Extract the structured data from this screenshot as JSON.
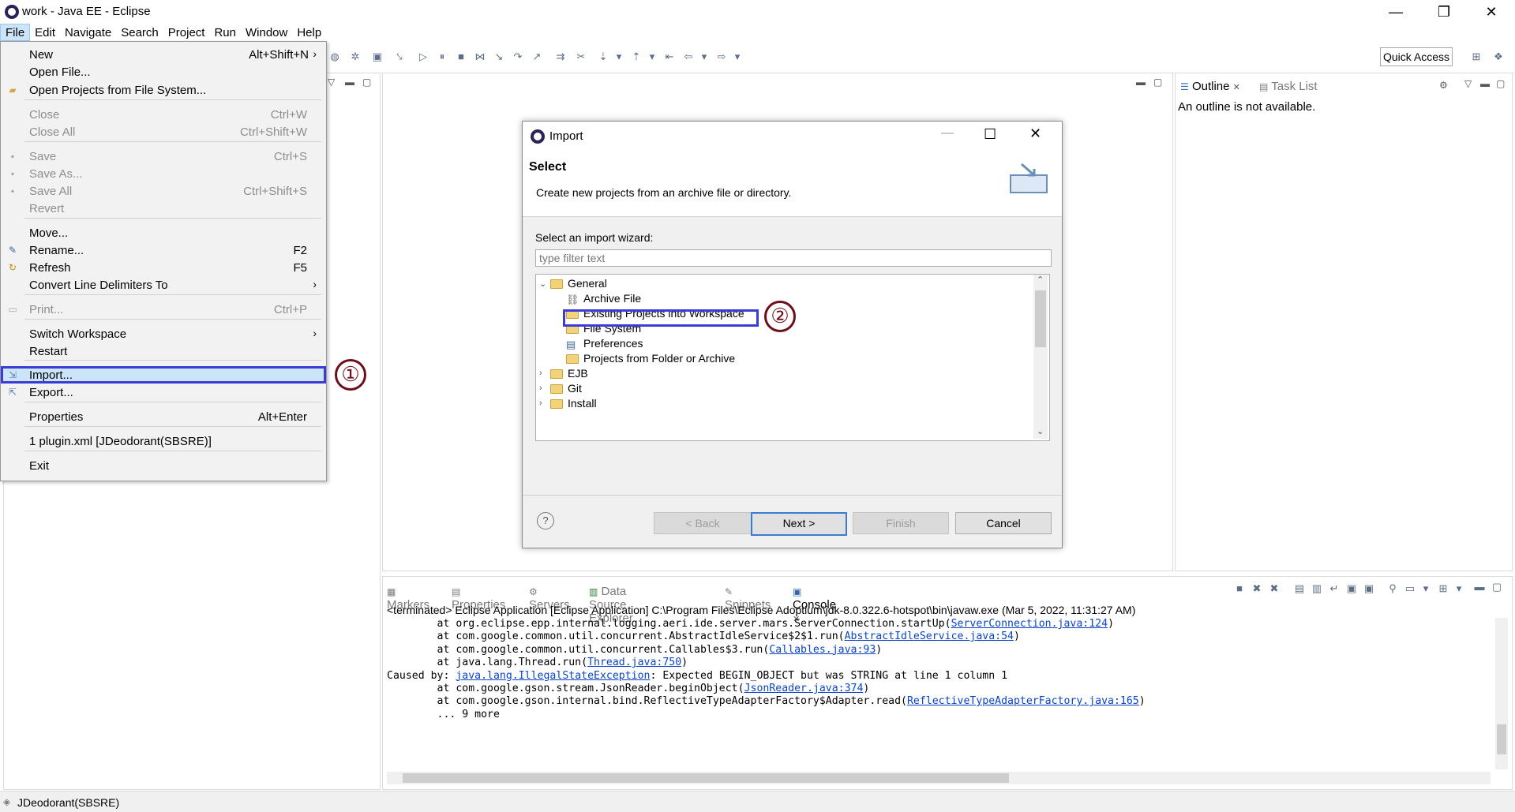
{
  "window": {
    "title": "work - Java EE - Eclipse",
    "controls": {
      "minimize": "—",
      "restore": "❐",
      "close": "✕"
    }
  },
  "menubar": [
    "File",
    "Edit",
    "Navigate",
    "Search",
    "Project",
    "Run",
    "Window",
    "Help"
  ],
  "toolbar": {
    "quick_access": "Quick Access"
  },
  "file_menu": {
    "items": [
      {
        "label": "New",
        "accel": "Alt+Shift+N",
        "submenu": "›"
      },
      {
        "label": "Open File..."
      },
      {
        "label": "Open Projects from File System..."
      },
      {
        "label": "Close",
        "accel": "Ctrl+W"
      },
      {
        "label": "Close All",
        "accel": "Ctrl+Shift+W"
      },
      {
        "label": "Save",
        "accel": "Ctrl+S"
      },
      {
        "label": "Save As..."
      },
      {
        "label": "Save All",
        "accel": "Ctrl+Shift+S"
      },
      {
        "label": "Revert"
      },
      {
        "label": "Move..."
      },
      {
        "label": "Rename...",
        "accel": "F2"
      },
      {
        "label": "Refresh",
        "accel": "F5"
      },
      {
        "label": "Convert Line Delimiters To",
        "submenu": "›"
      },
      {
        "label": "Print...",
        "accel": "Ctrl+P"
      },
      {
        "label": "Switch Workspace",
        "submenu": "›"
      },
      {
        "label": "Restart"
      },
      {
        "label": "Import..."
      },
      {
        "label": "Export..."
      },
      {
        "label": "Properties",
        "accel": "Alt+Enter"
      },
      {
        "label": "1 plugin.xml  [JDeodorant(SBSRE)]"
      },
      {
        "label": "Exit"
      }
    ]
  },
  "callouts": {
    "step1": "①",
    "step2": "②"
  },
  "outline": {
    "tabs": [
      "Outline",
      "Task List"
    ],
    "message": "An outline is not available."
  },
  "dialog": {
    "title": "Import",
    "heading": "Select",
    "description": "Create new projects from an archive file or directory.",
    "wizard_label": "Select an import wizard:",
    "filter_placeholder": "type filter text",
    "tree": [
      {
        "label": "General"
      },
      {
        "label": "Archive File"
      },
      {
        "label": "Existing Projects into Workspace"
      },
      {
        "label": "File System"
      },
      {
        "label": "Preferences"
      },
      {
        "label": "Projects from Folder or Archive"
      },
      {
        "label": "EJB"
      },
      {
        "label": "Git"
      },
      {
        "label": "Install"
      }
    ],
    "buttons": {
      "help": "?",
      "back": "< Back",
      "next": "Next >",
      "finish": "Finish",
      "cancel": "Cancel"
    }
  },
  "console": {
    "tabs": [
      "Markers",
      "Properties",
      "Servers",
      "Data Source Explorer",
      "Snippets",
      "Console"
    ],
    "header": "<terminated> Eclipse Application [Eclipse Application] C:\\Program Files\\Eclipse Adoptium\\jdk-8.0.322.6-hotspot\\bin\\javaw.exe (Mar 5, 2022, 11:31:27 AM)",
    "lines": [
      {
        "pre": "        at org.eclipse.epp.internal.logging.aeri.ide.server.mars.ServerConnection.startUp(",
        "link": "ServerConnection.java:124",
        "post": ")"
      },
      {
        "pre": "        at com.google.common.util.concurrent.AbstractIdleService$2$1.run(",
        "link": "AbstractIdleService.java:54",
        "post": ")"
      },
      {
        "pre": "        at com.google.common.util.concurrent.Callables$3.run(",
        "link": "Callables.java:93",
        "post": ")"
      },
      {
        "pre": "        at java.lang.Thread.run(",
        "link": "Thread.java:750",
        "post": ")"
      },
      {
        "pre": "Caused by: ",
        "link": "java.lang.IllegalStateException",
        "post": ": Expected BEGIN_OBJECT but was STRING at line 1 column 1"
      },
      {
        "pre": "        at com.google.gson.stream.JsonReader.beginObject(",
        "link": "JsonReader.java:374",
        "post": ")"
      },
      {
        "pre": "        at com.google.gson.internal.bind.ReflectiveTypeAdapterFactory$Adapter.read(",
        "link": "ReflectiveTypeAdapterFactory.java:165",
        "post": ")"
      },
      {
        "pre": "        ... 9 more",
        "link": "",
        "post": ""
      }
    ]
  },
  "statusbar": {
    "text": "JDeodorant(SBSRE)"
  },
  "colors": {
    "highlight_border": "#3b3bd6",
    "callout": "#6d0f1a",
    "link": "#0b44c7",
    "selection": "#cce4f7"
  }
}
